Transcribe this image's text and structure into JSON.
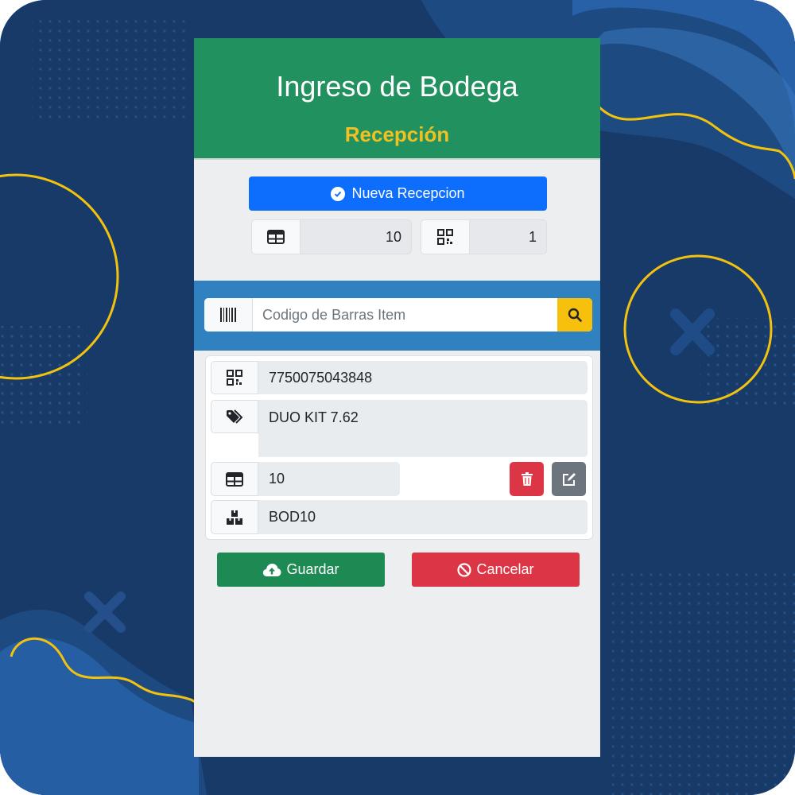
{
  "header": {
    "title": "Ingreso de Bodega",
    "subtitle": "Recepción"
  },
  "new_reception": {
    "label": "Nueva Recepcion",
    "icon": "check-circle-icon"
  },
  "counters": {
    "quantity": {
      "icon": "table-icon",
      "value": "10"
    },
    "items": {
      "icon": "qrcode-icon",
      "value": "1"
    }
  },
  "scan": {
    "icon": "barcode-icon",
    "placeholder": "Codigo de Barras Item",
    "search_icon": "search-icon"
  },
  "item": {
    "code": "7750075043848",
    "description": "DUO KIT 7.62",
    "quantity": "10",
    "warehouse": "BOD10"
  },
  "actions": {
    "save_label": "Guardar",
    "cancel_label": "Cancelar"
  },
  "colors": {
    "header_green": "#21915f",
    "accent_yellow": "#f2c020",
    "primary_blue": "#0d6efd",
    "scan_bar_blue": "#2f82bf",
    "danger_red": "#dc3545",
    "save_green": "#1e8a53",
    "background_navy": "#183a68"
  }
}
